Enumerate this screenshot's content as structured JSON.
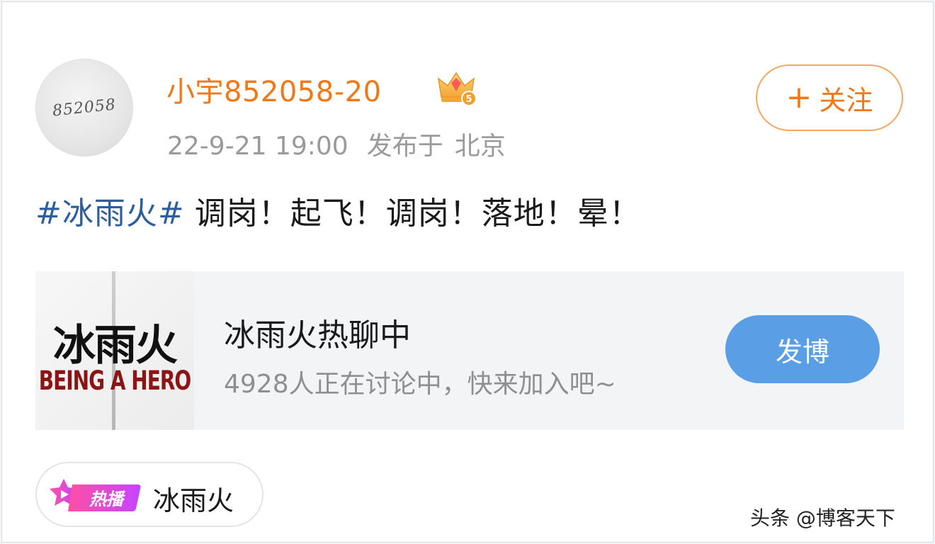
{
  "author": {
    "avatar_text": "852058",
    "username": "小宇852058-20",
    "badge_icon": "vip-crown-icon",
    "badge_level": "5",
    "timestamp": "22-9-21 19:00",
    "location_prefix": "发布于",
    "location": "北京"
  },
  "follow_button": {
    "plus": "+",
    "label": "关注"
  },
  "post": {
    "hashtag": "#冰雨火#",
    "text": "调岗！起飞！调岗！落地！晕！"
  },
  "topic": {
    "poster_title": "冰雨火",
    "poster_subtitle": "BEING A HERO",
    "title": "冰雨火热聊中",
    "subtitle": "4928人正在讨论中，快来加入吧~",
    "button": "发博"
  },
  "hot_chip": {
    "badge": "热播",
    "badge_icon": "play-star-icon",
    "label": "冰雨火"
  },
  "watermark": "头条 @博客天下",
  "colors": {
    "username": "#f07818",
    "hashtag": "#2f5e9c",
    "post_button": "#5a9ee6",
    "follow_border": "#f2a85e"
  }
}
